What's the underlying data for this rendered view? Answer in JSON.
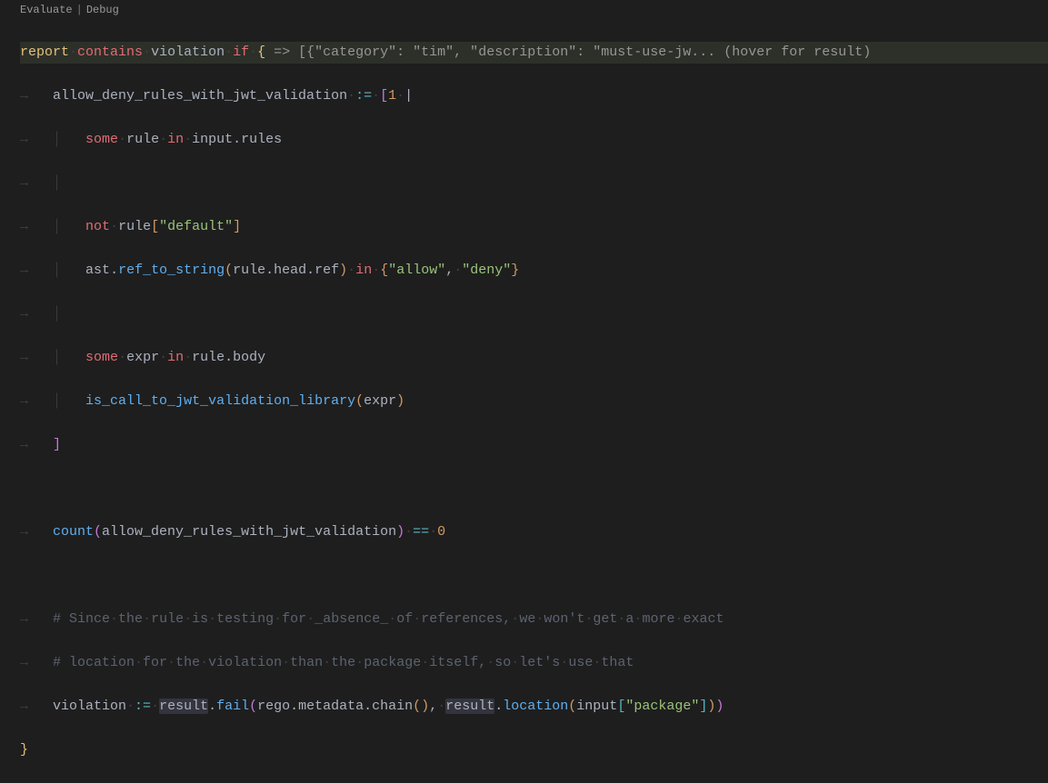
{
  "codelens": {
    "evaluate": "Evaluate",
    "debug": "Debug"
  },
  "inlay": {
    "arrow": " => ",
    "result": "[{\"category\": \"tim\", \"description\": \"must-use-jw... (hover for result)"
  },
  "tokens": {
    "report": "report",
    "contains": "contains",
    "violation": "violation",
    "if": "if",
    "lbrace": "{",
    "rbrace": "}",
    "allow_deny_var": "allow_deny_rules_with_jwt_validation",
    "assign": ":=",
    "lbrack": "[",
    "rbrack": "]",
    "one": "1",
    "pipe": "|",
    "some": "some",
    "rule": "rule",
    "in": "in",
    "input_rules": "input.rules",
    "not": "not",
    "idx_default": "\"default\"",
    "ast": "ast",
    "ref_to_string": "ref_to_string",
    "rule_head_ref": "rule.head.ref",
    "set_open": "{",
    "allow_str": "\"allow\"",
    "comma": ",",
    "deny_str": "\"deny\"",
    "set_close": "}",
    "expr": "expr",
    "rule_body": "rule.body",
    "is_call": "is_call_to_jwt_validation_library",
    "count": "count",
    "eq": "==",
    "zero": "0",
    "comment1": "# Since the rule is testing for _absence_ of references, we won't get a more exact",
    "comment2": "# location for the violation than the package itself, so let's use that",
    "violation2": "violation",
    "result": "result",
    "fail": "fail",
    "rego_meta_chain": "rego.metadata.chain",
    "location": "location",
    "input": "input",
    "package_str": "\"package\"",
    "dot": ".",
    "lparen": "(",
    "rparen": ")"
  },
  "ws": {
    "tab": "→   ",
    "dot": "·"
  }
}
